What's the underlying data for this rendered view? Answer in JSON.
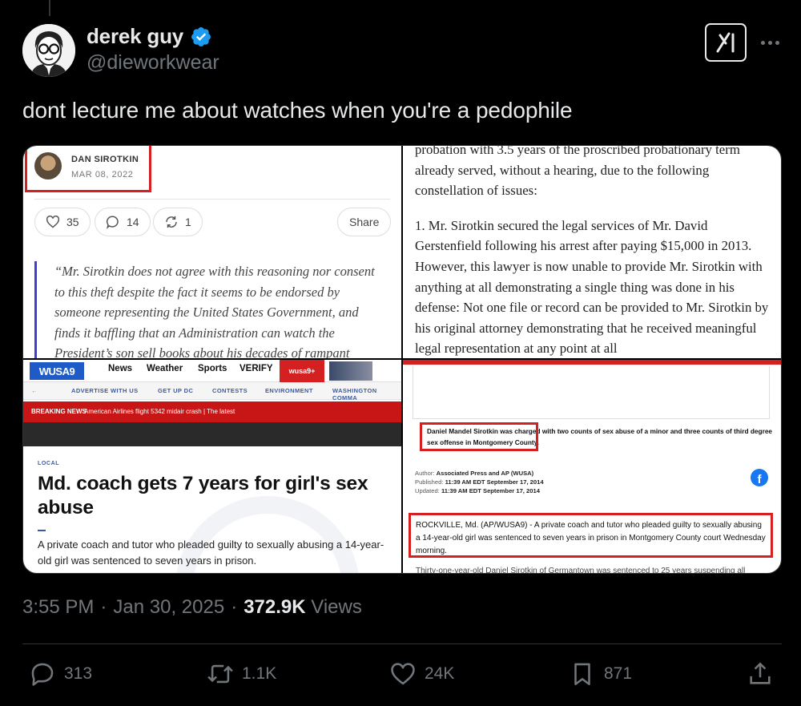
{
  "author": {
    "display_name": "derek guy",
    "handle": "@dieworkwear",
    "verified": true
  },
  "tweet": {
    "text": "dont lecture me about watches when you're a pedophile",
    "time": "3:55 PM",
    "date": "Jan 30, 2025",
    "views_count": "372.9K",
    "views_label": "Views"
  },
  "stats": {
    "replies": "313",
    "reposts": "1.1K",
    "likes": "24K",
    "bookmarks": "871"
  },
  "media": {
    "panel1": {
      "author": "DAN SIROTKIN",
      "date": "MAR 08, 2022",
      "likes": "35",
      "comments": "14",
      "restacks": "1",
      "share": "Share",
      "quote": "“Mr. Sirotkin does not agree with this reasoning nor consent to this theft despite the fact it seems to be endorsed by someone representing the United States Government, and finds it baffling that an Administration can watch the President’s son sell books about his decades of rampant criminal behavior, suffer no"
    },
    "panel2": {
      "line0": "probation with 3.5 years of the proscribed probationary term",
      "line1": "already served, without a hearing, due to the following constellation of issues:",
      "item": "1.      Mr. Sirotkin secured the legal services of Mr. David Gerstenfield following his arrest after paying $15,000 in 2013. However, this lawyer is now unable to provide Mr. Sirotkin with anything at all demonstrating a single thing was done in his defense: Not one file or record can be provided to Mr. Sirotkin by his original attorney demonstrating that he received meaningful legal representation at any point at all"
    },
    "panel3": {
      "logo": "WUSA9",
      "nav": [
        "News",
        "Weather",
        "Sports",
        "VERIFY"
      ],
      "plus": "wusa9+",
      "subnav": [
        "ADVERTISE WITH US",
        "GET UP DC",
        "CONTESTS",
        "ENVIRONMENT",
        "WASHINGTON COMMA"
      ],
      "breaking_label": "BREAKING NEWS",
      "breaking_text": "American Airlines flight 5342 midair crash | The latest",
      "section": "LOCAL",
      "headline": "Md. coach gets 7 years for girl's sex abuse",
      "lede": "A private coach and tutor who pleaded guilty to sexually abusing a 14-year-old girl was sentenced to seven years in prison."
    },
    "panel4": {
      "charged": "Daniel Mandel Sirotkin was charged with two counts of sex abuse of a minor and three counts of third degree sex offense in Montgomery County.",
      "author_label": "Author:",
      "author_value": "Associated Press and AP (WUSA)",
      "published_label": "Published:",
      "published_value": "11:39 AM EDT September 17, 2014",
      "updated_label": "Updated:",
      "updated_value": "11:39 AM EDT September 17, 2014",
      "body": "ROCKVILLE, Md. (AP/WUSA9) - A private coach and tutor who pleaded guilty to sexually abusing a 14-year-old girl was sentenced to seven years in prison in Montgomery County court Wednesday morning.",
      "cut": "Thirty-one-year-old Daniel Sirotkin of Germantown was sentenced to 25 years suspending all"
    }
  },
  "colors": {
    "background": "#000000",
    "text": "#e7e9ea",
    "muted": "#71767b",
    "verified": "#1d9bf0",
    "highlight_red": "#d42020"
  },
  "icons": {
    "verified": "verified-badge-icon",
    "grok": "grok-icon",
    "more": "more-horizontal-icon",
    "reply": "reply-icon",
    "repost": "repost-icon",
    "like": "heart-icon",
    "bookmark": "bookmark-icon",
    "share": "share-icon"
  }
}
